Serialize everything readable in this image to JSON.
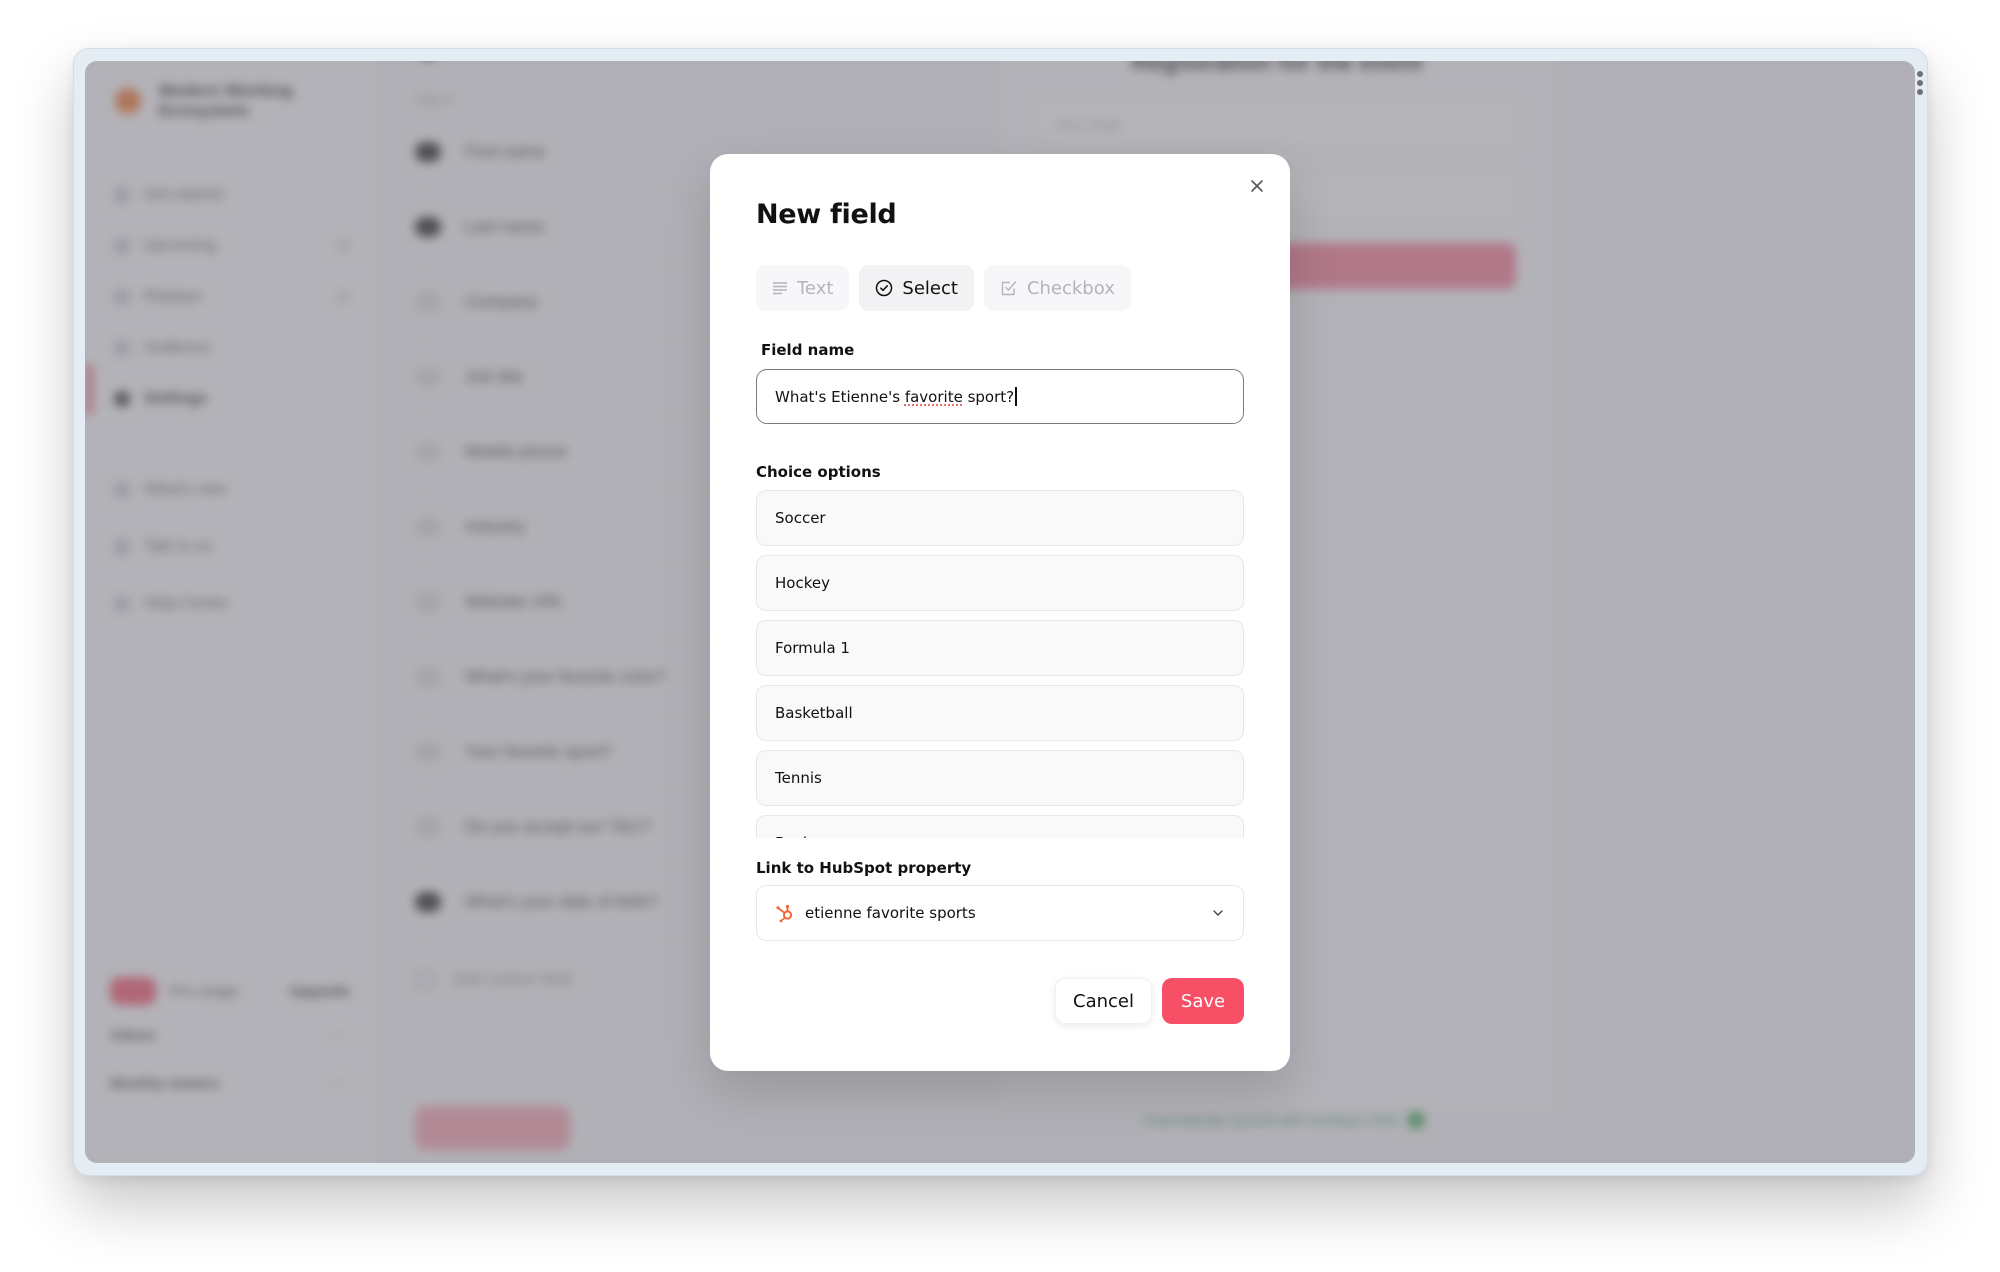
{
  "background_app": {
    "sidebar": {
      "brand": "Modern Working Ecosystem",
      "nav": [
        "Get started",
        "Upcoming",
        "Replays",
        "Audience",
        "Settings"
      ],
      "nav_secondary": [
        "What's new",
        "Talk to us",
        "Help Center"
      ],
      "active_item": "Settings",
      "plan": {
        "label": "Pro usage",
        "upgrade": "Upgrade"
      },
      "usage": [
        {
          "label": "Videos",
          "value": "- / -"
        },
        {
          "label": "Monthly viewers",
          "value": "- / -"
        }
      ]
    },
    "form_fields": {
      "top_field": "Email",
      "group_label": "Step 2",
      "fields": [
        {
          "label": "First name",
          "enabled": true
        },
        {
          "label": "Last name",
          "enabled": true
        },
        {
          "label": "Company",
          "enabled": false
        },
        {
          "label": "Job title",
          "enabled": false
        },
        {
          "label": "Mobile phone",
          "enabled": false
        },
        {
          "label": "Industry",
          "enabled": false
        },
        {
          "label": "Website URL",
          "enabled": false
        },
        {
          "label": "What's your favorite color?",
          "enabled": false
        },
        {
          "label": "Your favorite sport?",
          "enabled": false
        },
        {
          "label": "Do you accept our T&C?",
          "enabled": false
        },
        {
          "label": "What's your date of birth?",
          "enabled": true
        }
      ],
      "add_custom_field": "Add custom field"
    },
    "preview": {
      "title": "Registration for the event",
      "input_placeholder": "Your email",
      "footer_status": "Automatically synced with HubSpot CRM"
    }
  },
  "modal": {
    "title": "New field",
    "close_icon": "close-icon",
    "type_tabs": [
      {
        "label": "Text",
        "icon": "text-lines-icon",
        "active": false
      },
      {
        "label": "Select",
        "icon": "check-circle-icon",
        "active": true
      },
      {
        "label": "Checkbox",
        "icon": "checkbox-icon",
        "active": false
      }
    ],
    "field_name_label": "Field name",
    "field_name_value_before": "What's Etienne's ",
    "field_name_value_misspelled": "favorite",
    "field_name_value_after": " sport?",
    "choice_options_label": "Choice options",
    "choice_options": [
      "Soccer",
      "Hockey",
      "Formula 1",
      "Basketball",
      "Tennis",
      "Boxing"
    ],
    "link_label": "Link to HubSpot property",
    "hubspot_property": {
      "value": "etienne favorite sports",
      "icon": "hubspot-icon",
      "icon_color": "#f2653a"
    },
    "cancel_label": "Cancel",
    "save_label": "Save",
    "accent_color": "#f74f66"
  }
}
